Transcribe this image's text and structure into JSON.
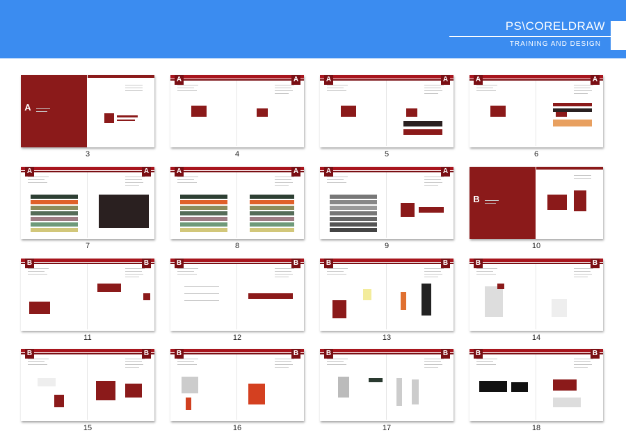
{
  "header": {
    "title": "PS\\CORELDRAW",
    "subtitle": "TRAINING  AND  DESIGN"
  },
  "colors": {
    "header_bg": "#3b8cf0",
    "brand_red": "#8b1a1a"
  },
  "pages": [
    {
      "number": "3",
      "section": "A"
    },
    {
      "number": "4",
      "section": "A"
    },
    {
      "number": "5",
      "section": "A"
    },
    {
      "number": "6",
      "section": "A"
    },
    {
      "number": "7",
      "section": "A"
    },
    {
      "number": "8",
      "section": "A"
    },
    {
      "number": "9",
      "section": "A"
    },
    {
      "number": "10",
      "section": "B"
    },
    {
      "number": "11",
      "section": "B"
    },
    {
      "number": "12",
      "section": "B"
    },
    {
      "number": "13",
      "section": "B"
    },
    {
      "number": "14",
      "section": "B"
    },
    {
      "number": "15",
      "section": "B"
    },
    {
      "number": "16",
      "section": "B"
    },
    {
      "number": "17",
      "section": "B"
    },
    {
      "number": "18",
      "section": "B"
    }
  ]
}
